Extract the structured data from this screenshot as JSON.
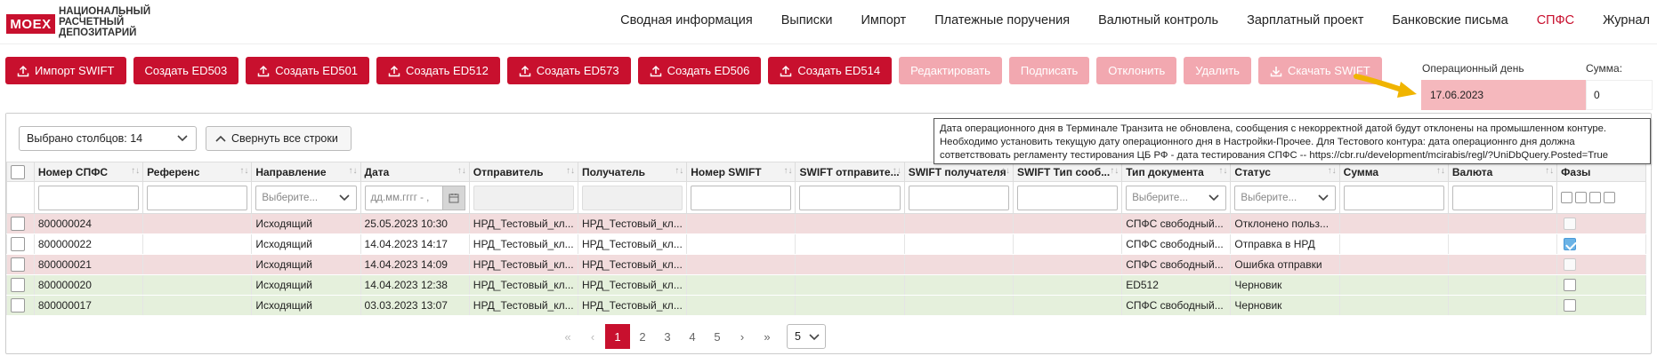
{
  "brand": {
    "logo_mark": "MOEX",
    "logo_line1": "НАЦИОНАЛЬНЫЙ",
    "logo_line2": "РАСЧЕТНЫЙ",
    "logo_line3": "ДЕПОЗИТАРИЙ"
  },
  "nav": [
    {
      "label": "Сводная информация"
    },
    {
      "label": "Выписки"
    },
    {
      "label": "Импорт"
    },
    {
      "label": "Платежные поручения"
    },
    {
      "label": "Валютный контроль"
    },
    {
      "label": "Зарплатный проект"
    },
    {
      "label": "Банковские письма"
    },
    {
      "label": "СПФС"
    },
    {
      "label": "Журнал"
    }
  ],
  "nav_active": "СПФС",
  "toolbar": {
    "buttons": [
      {
        "label": "Импорт SWIFT",
        "icon": "upload-icon",
        "enabled": true
      },
      {
        "label": "Создать ED503",
        "icon": "",
        "enabled": true
      },
      {
        "label": "Создать ED501",
        "icon": "upload-icon",
        "enabled": true
      },
      {
        "label": "Создать ED512",
        "icon": "upload-icon",
        "enabled": true
      },
      {
        "label": "Создать ED573",
        "icon": "upload-icon",
        "enabled": true
      },
      {
        "label": "Создать ED506",
        "icon": "upload-icon",
        "enabled": true
      },
      {
        "label": "Создать ED514",
        "icon": "upload-icon",
        "enabled": true
      },
      {
        "label": "Редактировать",
        "icon": "",
        "enabled": false
      },
      {
        "label": "Подписать",
        "icon": "",
        "enabled": false
      },
      {
        "label": "Отклонить",
        "icon": "",
        "enabled": false
      },
      {
        "label": "Удалить",
        "icon": "",
        "enabled": false
      },
      {
        "label": "Скачать SWIFT",
        "icon": "download-icon",
        "enabled": false
      }
    ]
  },
  "opday": {
    "label": "Операционный день",
    "value": "17.06.2023",
    "sum_label": "Сумма:",
    "sum_value": "0"
  },
  "grid_controls": {
    "columns_selected": "Выбрано столбцов: 14",
    "collapse_label": "Свернуть все строки"
  },
  "tooltip": {
    "line1": "Дата операционного дня в Терминале Транзита не обновлена, сообщения с некорректной датой будут отклонены на промышленном контуре.",
    "line2": "Необходимо установить текущую дату операционного дня в Настройки-Прочее. Для Тестового контура: дата операционнго дня должна",
    "line3": "сответствовать регламенту тестирования ЦБ РФ - дата тестирования СПФС -- https://cbr.ru/development/mcirabis/regl/?UniDbQuery.Posted=True"
  },
  "columns": [
    {
      "label": "Номер СПФС",
      "filter": "text",
      "placeholder": ""
    },
    {
      "label": "Референс",
      "filter": "text",
      "placeholder": ""
    },
    {
      "label": "Направление",
      "filter": "select",
      "placeholder": "Выберите..."
    },
    {
      "label": "Дата",
      "filter": "date",
      "placeholder": "дд.мм.гггг - ,"
    },
    {
      "label": "Отправитель",
      "filter": "disabled",
      "placeholder": ""
    },
    {
      "label": "Получатель",
      "filter": "disabled",
      "placeholder": ""
    },
    {
      "label": "Номер SWIFT",
      "filter": "text",
      "placeholder": ""
    },
    {
      "label": "SWIFT отправите...",
      "filter": "text",
      "placeholder": ""
    },
    {
      "label": "SWIFT получателя",
      "filter": "text",
      "placeholder": ""
    },
    {
      "label": "SWIFT Тип сооб...",
      "filter": "text",
      "placeholder": ""
    },
    {
      "label": "Тип документа",
      "filter": "select",
      "placeholder": "Выберите..."
    },
    {
      "label": "Статус",
      "filter": "select",
      "placeholder": "Выберите..."
    },
    {
      "label": "Сумма",
      "filter": "text",
      "placeholder": ""
    },
    {
      "label": "Валюта",
      "filter": "text",
      "placeholder": ""
    },
    {
      "label": "Фазы",
      "filter": "phases",
      "placeholder": ""
    }
  ],
  "rows": [
    {
      "tone": "red",
      "cells": [
        "800000024",
        "",
        "Исходящий",
        "25.05.2023 10:30",
        "НРД_Тестовый_кл...",
        "НРД_Тестовый_кл...",
        "",
        "",
        "",
        "",
        "СПФС свободный...",
        "Отклонено польз...",
        "",
        ""
      ],
      "phase": "light"
    },
    {
      "tone": "white",
      "cells": [
        "800000022",
        "",
        "Исходящий",
        "14.04.2023 14:17",
        "НРД_Тестовый_кл...",
        "НРД_Тестовый_кл...",
        "",
        "",
        "",
        "",
        "СПФС свободный...",
        "Отправка в НРД",
        "",
        ""
      ],
      "phase": "checked"
    },
    {
      "tone": "red",
      "cells": [
        "800000021",
        "",
        "Исходящий",
        "14.04.2023 14:09",
        "НРД_Тестовый_кл...",
        "НРД_Тестовый_кл...",
        "",
        "",
        "",
        "",
        "СПФС свободный...",
        "Ошибка отправки",
        "",
        ""
      ],
      "phase": "light"
    },
    {
      "tone": "green",
      "cells": [
        "800000020",
        "",
        "Исходящий",
        "14.04.2023 12:38",
        "НРД_Тестовый_кл...",
        "НРД_Тестовый_кл...",
        "",
        "",
        "",
        "",
        "ED512",
        "Черновик",
        "",
        ""
      ],
      "phase": "empty"
    },
    {
      "tone": "green",
      "cells": [
        "800000017",
        "",
        "Исходящий",
        "03.03.2023 13:07",
        "НРД_Тестовый_кл...",
        "НРД_Тестовый_кл...",
        "",
        "",
        "",
        "",
        "СПФС свободный...",
        "Черновик",
        "",
        ""
      ],
      "phase": "empty"
    }
  ],
  "pagination": {
    "first": "«",
    "prev": "‹",
    "pages": [
      "1",
      "2",
      "3",
      "4",
      "5"
    ],
    "current": "1",
    "next": "›",
    "last": "»",
    "page_size": "5"
  },
  "colors": {
    "accent": "#c8102e",
    "accent_disabled": "#f2a8b0",
    "row_red": "#f2dcdd",
    "row_green": "#e5f0dc",
    "opday_bg": "#f5b8bd",
    "arrow": "#f0b400"
  }
}
